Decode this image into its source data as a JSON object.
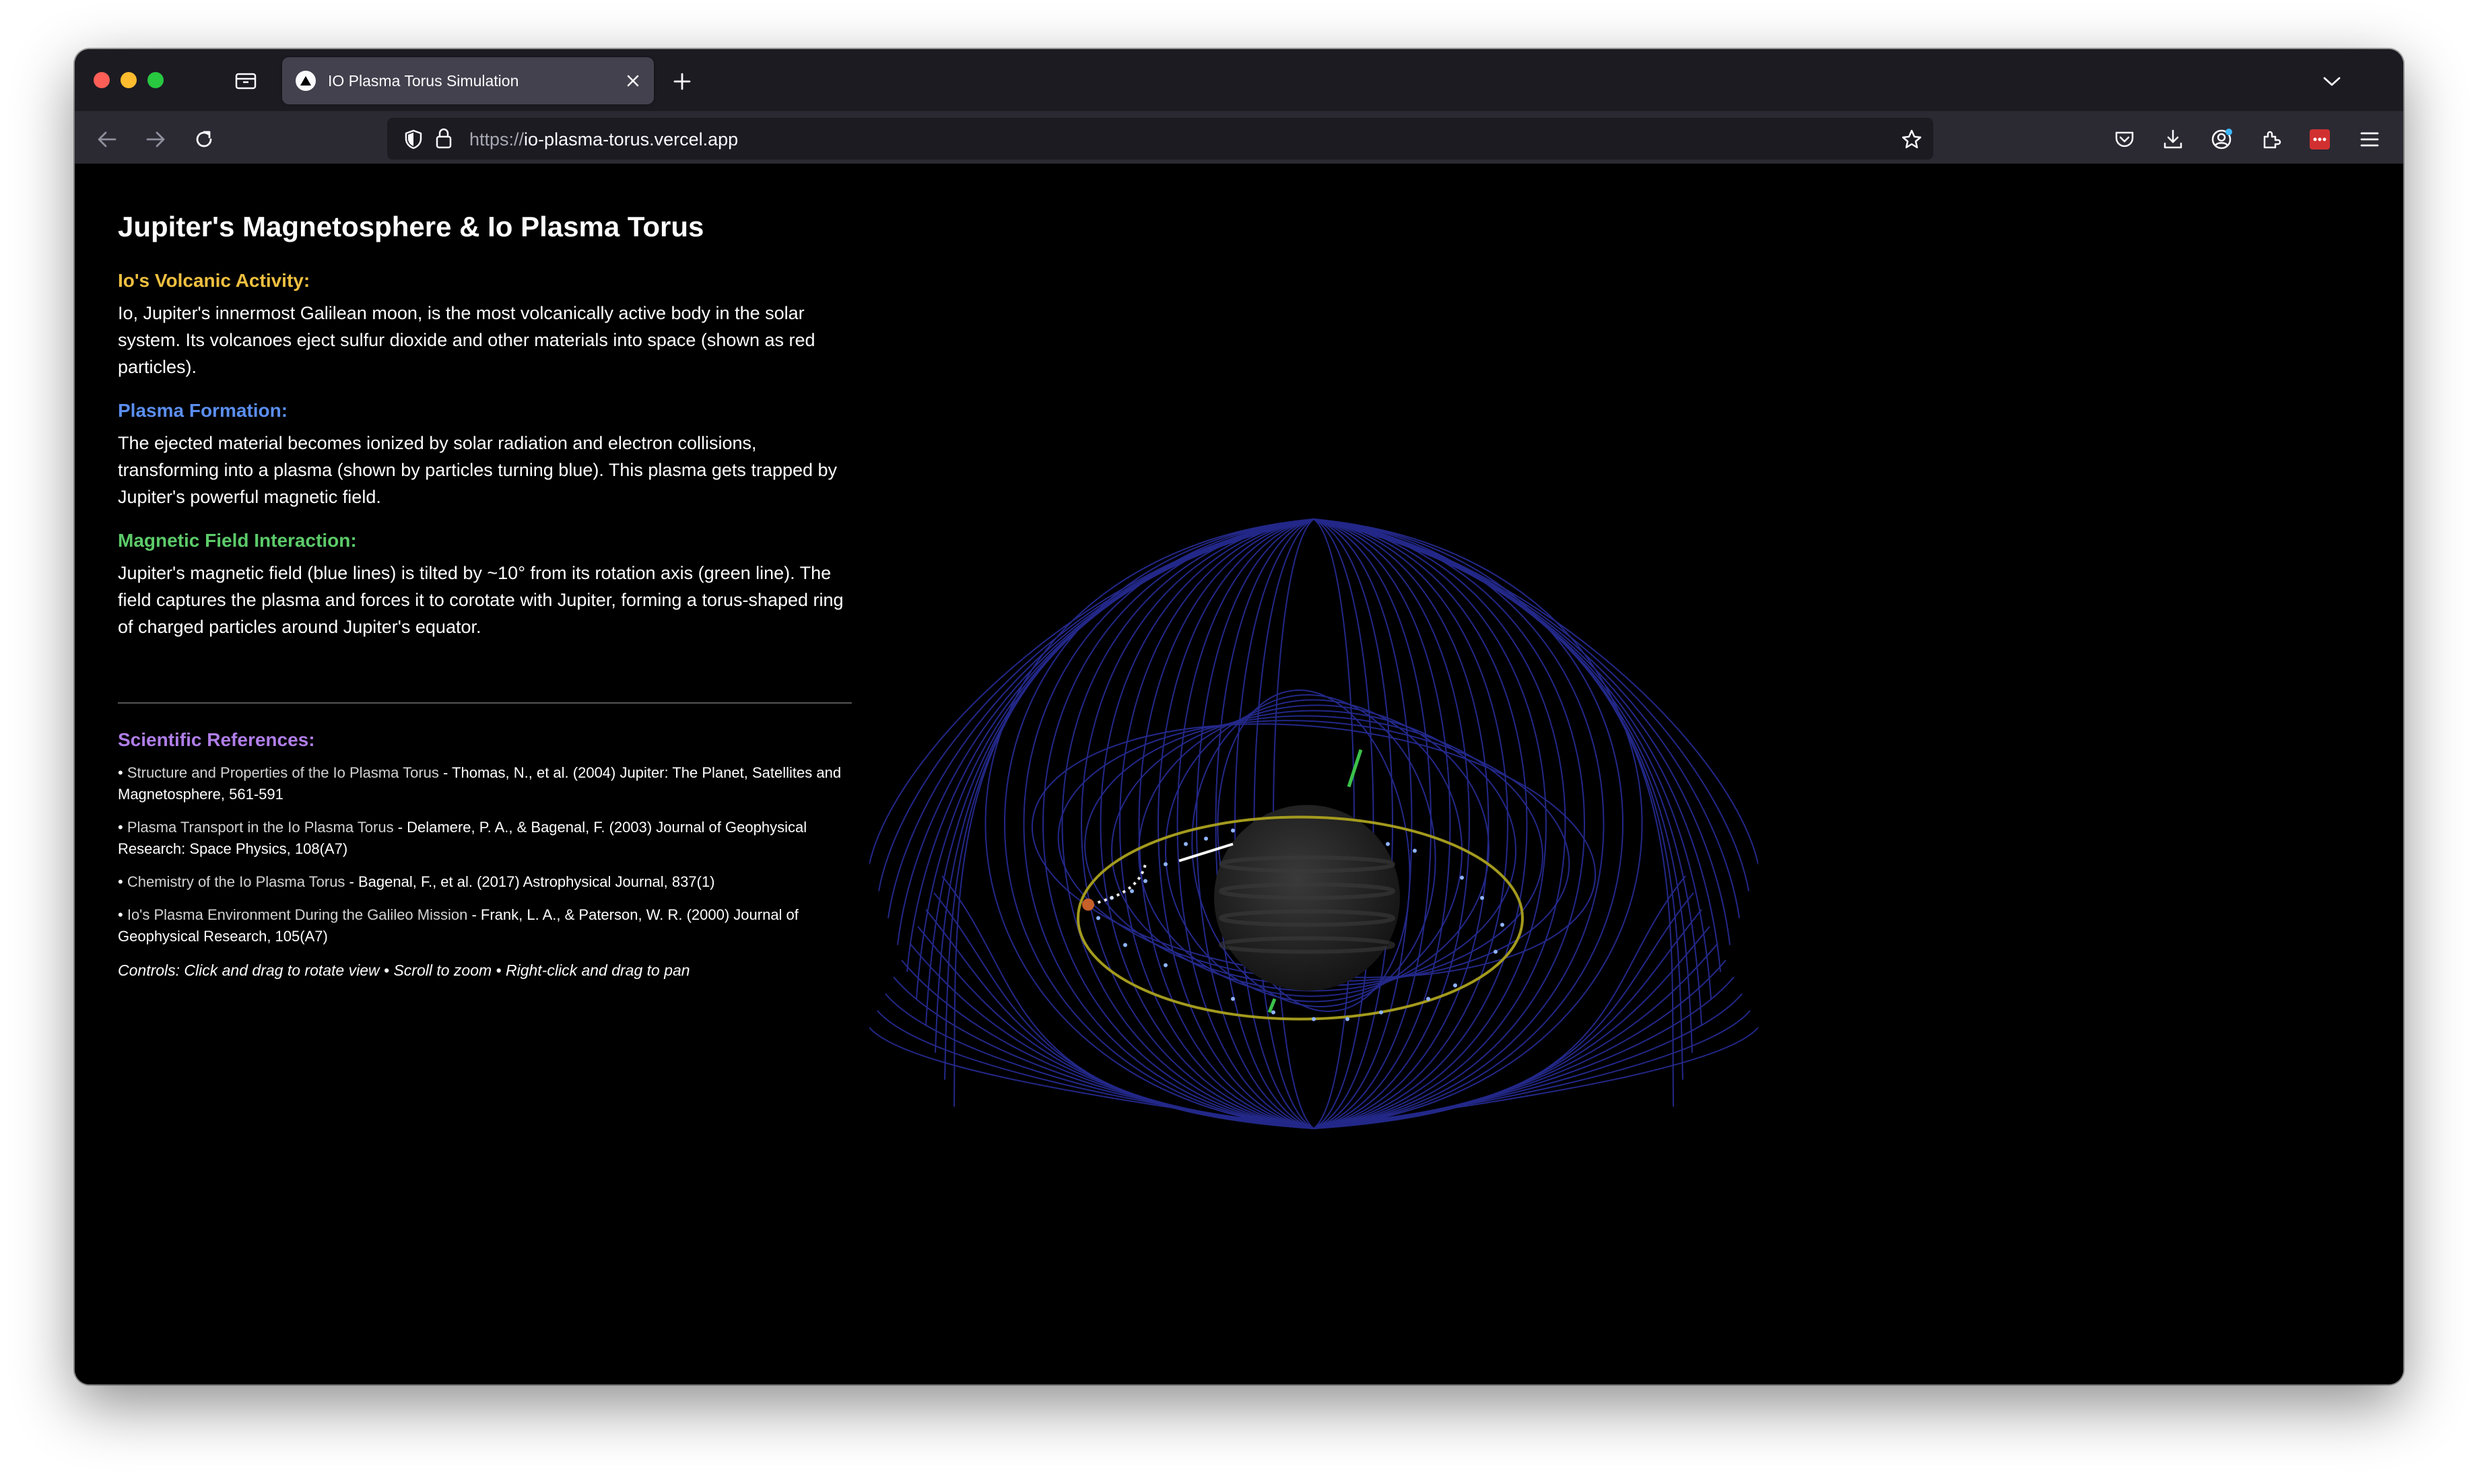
{
  "browser": {
    "tab": {
      "title": "IO Plasma Torus Simulation"
    },
    "url": {
      "scheme": "https://",
      "host": "io-plasma-torus.vercel.app"
    }
  },
  "page": {
    "title": "Jupiter's Magnetosphere & Io Plasma Torus",
    "sections": [
      {
        "heading": "Io's Volcanic Activity:",
        "color": "#f0c040",
        "body": "Io, Jupiter's innermost Galilean moon, is the most volcanically active body in the solar system. Its volcanoes eject sulfur dioxide and other materials into space (shown as red particles)."
      },
      {
        "heading": "Plasma Formation:",
        "color": "#5b8ef0",
        "body": "The ejected material becomes ionized by solar radiation and electron collisions, transforming into a plasma (shown by particles turning blue). This plasma gets trapped by Jupiter's powerful magnetic field."
      },
      {
        "heading": "Magnetic Field Interaction:",
        "color": "#5ccb6a",
        "body": "Jupiter's magnetic field (blue lines) is tilted by ~10° from its rotation axis (green line). The field captures the plasma and forces it to corotate with Jupiter, forming a torus-shaped ring of charged particles around Jupiter's equator."
      }
    ],
    "references": {
      "heading": "Scientific References:",
      "color": "#b07ee8",
      "items": [
        {
          "bullet": "•",
          "title": "Structure and Properties of the Io Plasma Torus",
          "citation": " - Thomas, N., et al. (2004) Jupiter: The Planet, Satellites and Magnetosphere, 561-591"
        },
        {
          "bullet": "•",
          "title": "Plasma Transport in the Io Plasma Torus",
          "citation": " - Delamere, P. A., & Bagenal, F. (2003) Journal of Geophysical Research: Space Physics, 108(A7)"
        },
        {
          "bullet": "•",
          "title": "Chemistry of the Io Plasma Torus",
          "citation": " - Bagenal, F., et al. (2017) Astrophysical Journal, 837(1)"
        },
        {
          "bullet": "•",
          "title": "Io's Plasma Environment During the Galileo Mission",
          "citation": " - Frank, L. A., & Paterson, W. R. (2000) Journal of Geophysical Research, 105(A7)"
        }
      ]
    },
    "controls_hint": "Controls: Click and drag to rotate view • Scroll to zoom • Right-click and drag to pan"
  },
  "simulation": {
    "field_line_color": "#2a2fa0",
    "rotation_axis_color": "#3cc24a",
    "torus_color": "#a39a1e",
    "planet_color": "#2a2a2a",
    "io_color": "#c8602a",
    "plasma_color": "#8fb4ff"
  }
}
